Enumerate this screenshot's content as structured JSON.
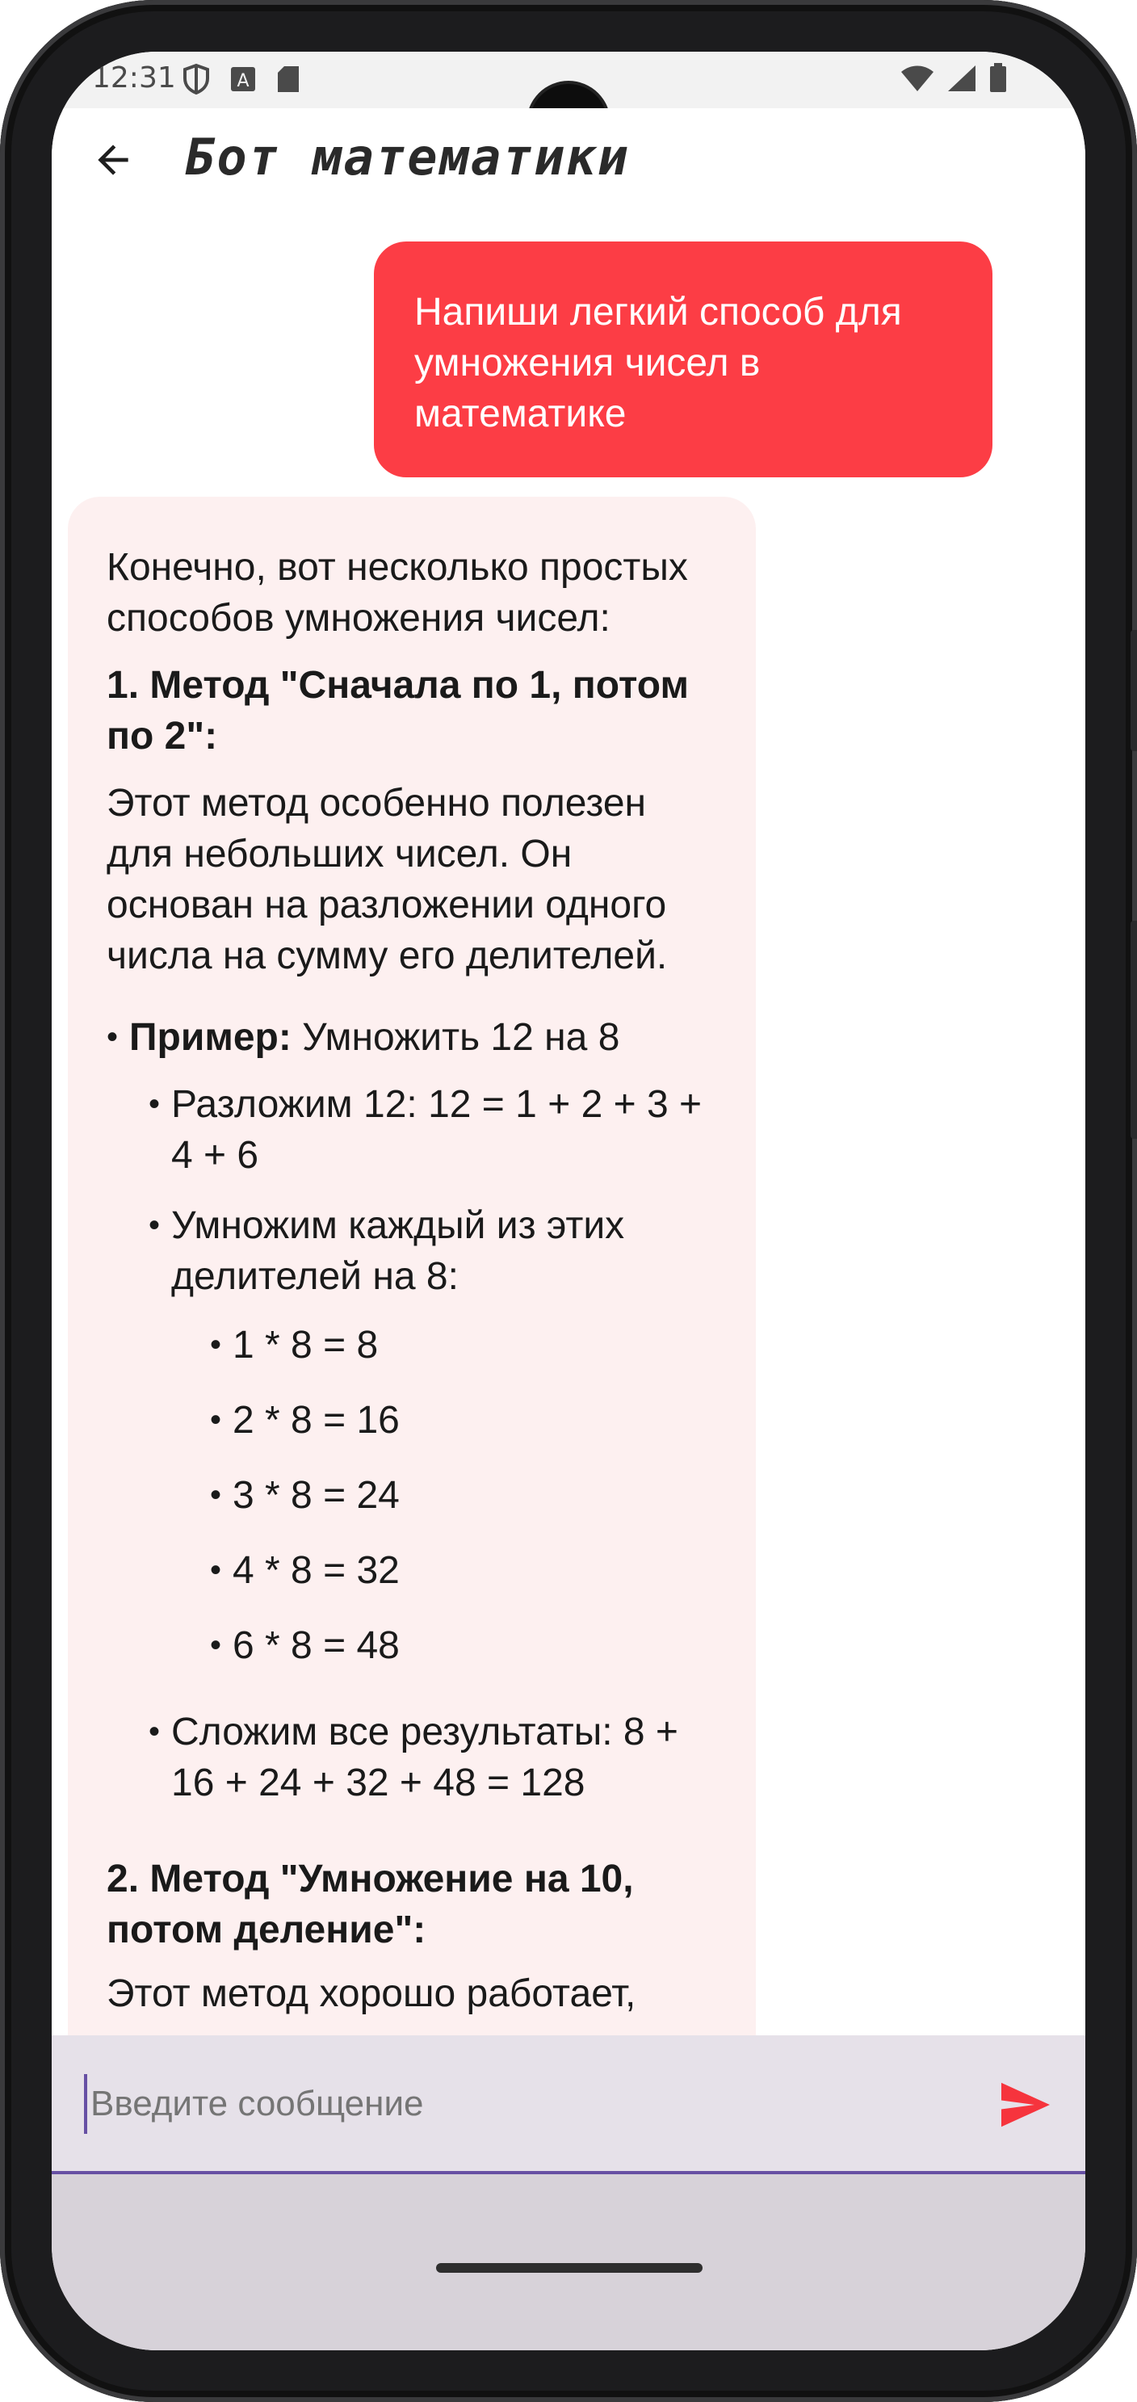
{
  "status_bar": {
    "time": "12:31"
  },
  "app_bar": {
    "title": "Бот математики"
  },
  "messages": {
    "user": "Напиши легкий способ для умножения чисел в математике",
    "bot": {
      "intro": "Конечно, вот несколько простых способов умножения чисел:",
      "method1_title": "1. Метод \"Сначала по 1, потом по 2\":",
      "method1_desc": "Этот метод особенно полезен для небольших чисел. Он основан на разложении одного числа на сумму его делителей.",
      "example_label": "Пример:",
      "example_text": " Умножить 12 на 8",
      "step1": "Разложим 12: 12 = 1 + 2 + 3 + 4 + 6",
      "step2": "Умножим каждый из этих делителей на 8:",
      "products": [
        "1 * 8 = 8",
        "2 * 8 = 16",
        "3 * 8 = 24",
        "4 * 8 = 32",
        "6 * 8 = 48"
      ],
      "step3": "Сложим все результаты: 8 + 16 + 24 + 32 + 48 = 128",
      "method2_title": "2. Метод \"Умножение на 10, потом деление\":",
      "method2_desc": "Этот метод хорошо работает,"
    }
  },
  "input": {
    "placeholder": "Введите сообщение"
  },
  "colors": {
    "user_bubble": "#fc3d45",
    "bot_bubble": "#fdf0f0",
    "input_bar": "#e6e1e9",
    "send_icon": "#f6343d",
    "accent": "#6750a4"
  }
}
